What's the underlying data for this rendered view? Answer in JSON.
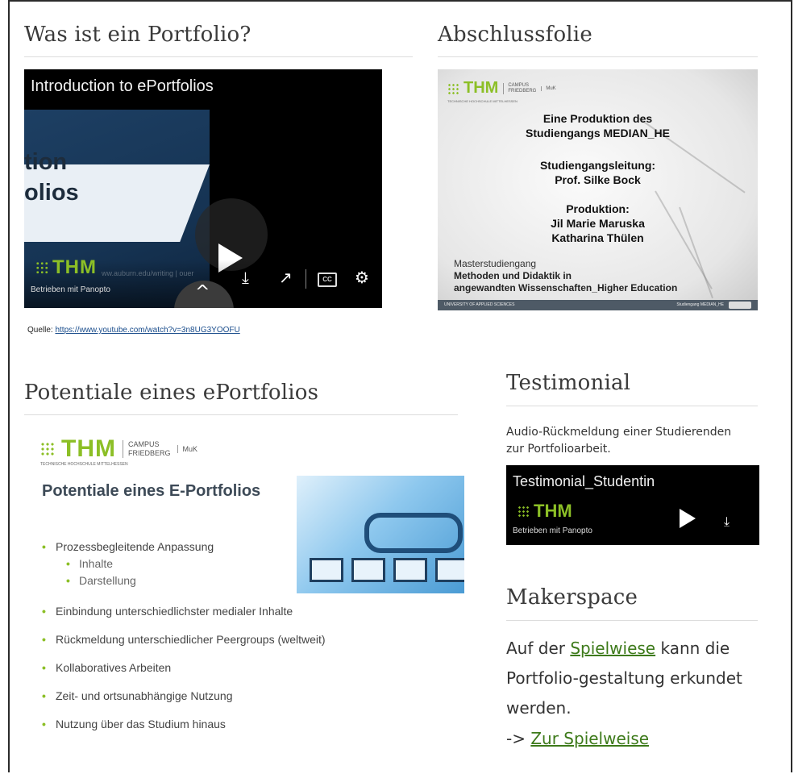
{
  "sections": {
    "portfolio": {
      "heading": "Was ist ein Portfolio?"
    },
    "closing": {
      "heading": "Abschlussfolie"
    },
    "potentiale": {
      "heading": "Potentiale eines ePortfolios"
    },
    "testimonial": {
      "heading": "Testimonial"
    },
    "makerspace": {
      "heading": "Makerspace"
    }
  },
  "video": {
    "title": "Introduction to ePortfolios",
    "slide_text_line1": "tion",
    "slide_text_line2": "olios",
    "logo_text": "THM",
    "url_ghost": "ww.auburn.edu/writing | ouer",
    "powered_by": "Betrieben mit Panopto",
    "cc_label": "CC"
  },
  "source": {
    "label": "Quelle: ",
    "link": "https://www.youtube.com/watch?v=3n8UG3YOOFU"
  },
  "closing_slide": {
    "logo": "THM",
    "campus_line1": "CAMPUS",
    "campus_line2": "FRIEDBERG",
    "muk": "MuK",
    "logo_subtext": "TECHNISCHE HOCHSCHULE MITTELHESSEN",
    "line1": "Eine Produktion des",
    "line2": "Studiengangs MEDIAN_HE",
    "line3": "Studiengangsleitung:",
    "line4": "Prof. Silke Bock",
    "line5": "Produktion:",
    "line6": "Jil Marie Maruska",
    "line7": "Katharina Thülen",
    "master1": "Masterstudiengang",
    "master2": "Methoden und Didaktik in",
    "master3": "angewandten Wissenschaften_Higher Education",
    "footer_left": "UNIVERSITY OF APPLIED SCIENCES",
    "footer_right": "Studiengang MEDIAN_HE"
  },
  "potentiale_slide": {
    "logo": "THM",
    "campus_line1": "CAMPUS",
    "campus_line2": "FRIEDBERG",
    "muk": "MuK",
    "logo_subtext": "TECHNISCHE HOCHSCHULE MITTELHESSEN",
    "title": "Potentiale eines E-Portfolios",
    "bullets": [
      "Prozessbegleitende Anpassung",
      "Inhalte",
      "Darstellung",
      "Einbindung unterschiedlichster medialer Inhalte",
      "Rückmeldung unterschiedlicher Peergroups (weltweit)",
      "Kollaboratives Arbeiten",
      "Zeit- und ortsunabhängige Nutzung",
      "Nutzung über das Studium hinaus"
    ]
  },
  "testimonial": {
    "text_line1": "Audio-Rückmeldung einer Studierenden",
    "text_line2": "zur Portfolioarbeit.",
    "player_title": "Testimonial_Studentin",
    "logo": "THM",
    "powered_by": "Betrieben mit Panopto"
  },
  "makerspace": {
    "text_before": "Auf der ",
    "link1": "Spielwiese",
    "text_after": " kann die Portfolio-gestaltung erkundet werden.",
    "arrow": "-> ",
    "link2": "Zur Spielweise"
  },
  "colors": {
    "thm_green": "#8cbf26",
    "link_green": "#3d7a1a",
    "heading_text": "#3a3a3a"
  }
}
